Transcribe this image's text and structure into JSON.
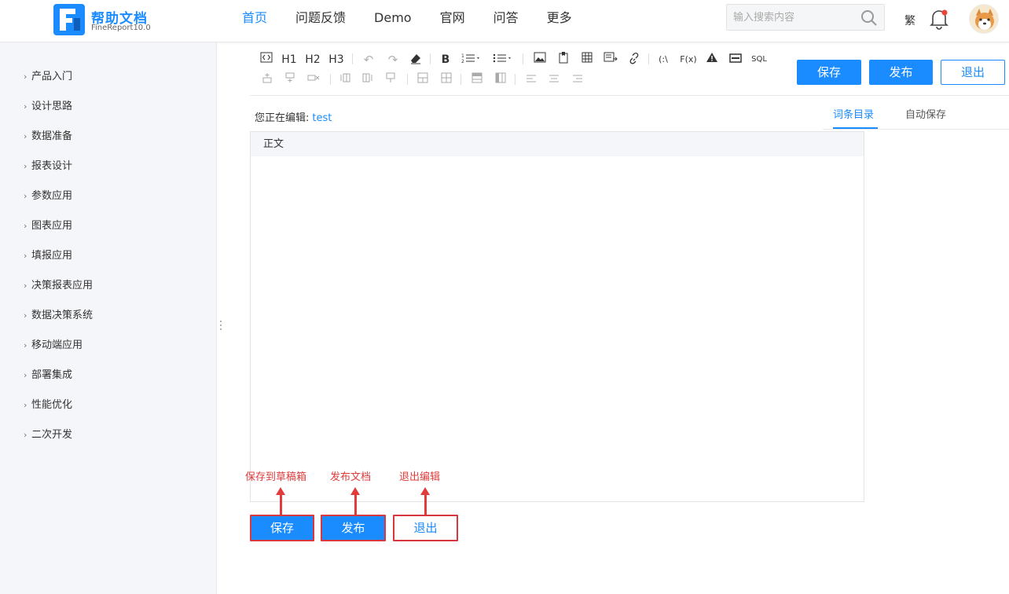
{
  "header": {
    "logo_title": "帮助文档",
    "logo_subtitle": "FineReport10.0",
    "nav": [
      "首页",
      "问题反馈",
      "Demo",
      "官网",
      "问答",
      "更多"
    ],
    "active_nav_index": 0,
    "search_placeholder": "输入搜索内容",
    "traditional_toggle": "繁",
    "accent_color": "#1a8cff"
  },
  "sidebar": {
    "items": [
      "产品入门",
      "设计思路",
      "数据准备",
      "报表设计",
      "参数应用",
      "图表应用",
      "填报应用",
      "决策报表应用",
      "数据决策系统",
      "移动端应用",
      "部署集成",
      "性能优化",
      "二次开发"
    ]
  },
  "toolbar": {
    "row1_icons": [
      "code-icon",
      "heading1-icon",
      "heading2-icon",
      "heading3-icon",
      "undo-icon",
      "redo-icon",
      "eraser-icon",
      "bold-icon",
      "ordered-list-icon",
      "unordered-list-icon",
      "image-icon",
      "attachment-icon",
      "table-icon",
      "template-icon",
      "link-icon",
      "formula-icon",
      "function-icon",
      "warning-icon",
      "divider-block-icon",
      "sql-icon"
    ],
    "row2_icons": [
      "insert-row-above-icon",
      "insert-row-below-icon",
      "delete-row-icon",
      "insert-col-left-icon",
      "insert-col-right-icon",
      "delete-col-icon",
      "merge-cells-icon",
      "split-cells-icon",
      "table-header-row-icon",
      "table-header-col-icon",
      "align-left-icon",
      "align-center-icon",
      "align-right-icon"
    ],
    "h1": "H1",
    "h2": "H2",
    "h3": "H3",
    "bold": "B",
    "formula": "(:\\",
    "function": "F(x)",
    "sql": "SQL",
    "save_label": "保存",
    "publish_label": "发布",
    "exit_label": "退出"
  },
  "editing": {
    "prefix": "您正在编辑:",
    "doc_name": "test"
  },
  "tabs": [
    "词条目录",
    "自动保存"
  ],
  "editor": {
    "section_title": "正文"
  },
  "annotations": {
    "save_note": "保存到草稿箱",
    "publish_note": "发布文档",
    "exit_note": "退出编辑",
    "color": "#e03c3c"
  },
  "bottom_buttons": {
    "save_label": "保存",
    "publish_label": "发布",
    "exit_label": "退出"
  }
}
